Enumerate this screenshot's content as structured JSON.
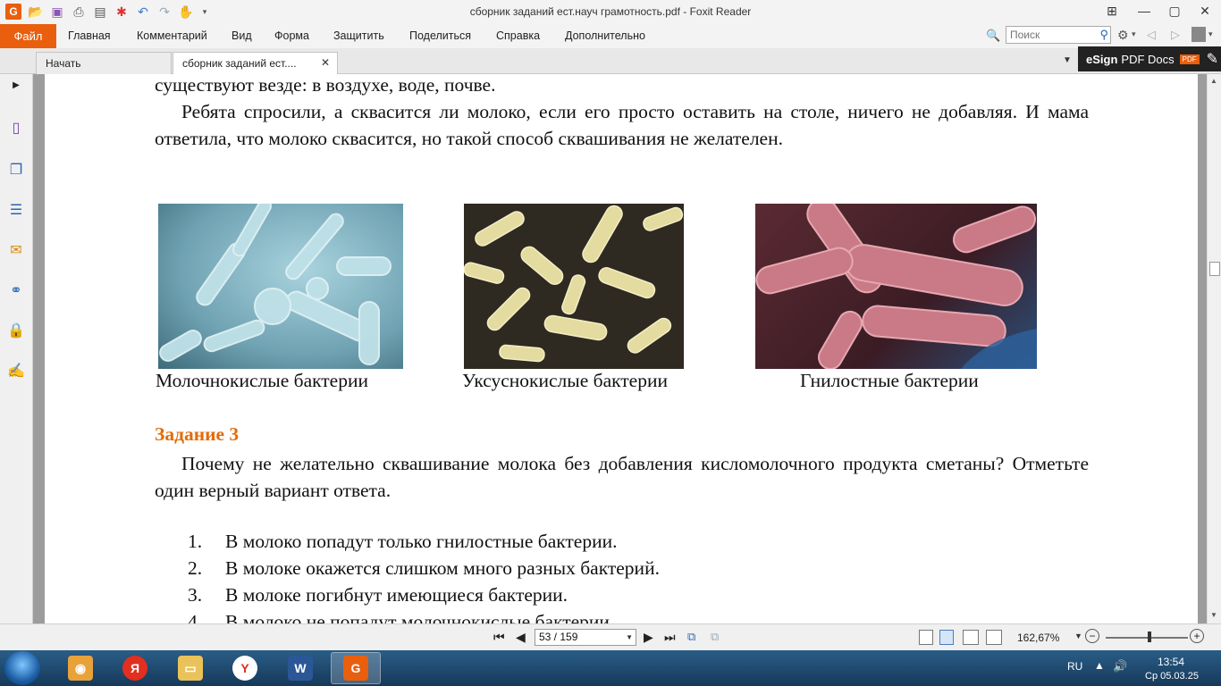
{
  "window": {
    "title": "сборник заданий ест.науч грамотность.pdf - Foxit Reader",
    "controls": {
      "ribbon_toggle": "⊞",
      "minimize": "—",
      "maximize": "▢",
      "close": "✕"
    }
  },
  "menu": {
    "file": "Файл",
    "items": [
      "Главная",
      "Комментарий",
      "Вид",
      "Форма",
      "Защитить",
      "Поделиться",
      "Справка",
      "Дополнительно"
    ]
  },
  "search": {
    "placeholder": "Поиск"
  },
  "tabs": [
    {
      "label": "Начать"
    },
    {
      "label": "сборник заданий ест...."
    }
  ],
  "esign": {
    "brand": "eSign",
    "label": "PDF Docs",
    "badge": "PDF"
  },
  "document": {
    "line_top": "существуют везде: в воздухе, воде, почве.",
    "paragraph1": "Ребята спросили, а сквасится ли молоко, если его просто оставить на столе, ничего не добавляя. И мама ответила, что молоко сквасится, но такой способ сквашивания не желателен.",
    "captions": [
      "Молочнокислые бактерии",
      "Уксуснокислые бактерии",
      "Гнилостные бактерии"
    ],
    "task_heading": "Задание 3",
    "question": "Почему не желательно сквашивание молока без добавления кисломолочного продукта сметаны? Отметьте один верный вариант ответа.",
    "options": [
      {
        "num": "1.",
        "text": "В молоко попадут только гнилостные бактерии."
      },
      {
        "num": "2.",
        "text": "В молоке окажется слишком много разных бактерий."
      },
      {
        "num": "3.",
        "text": "В молоке погибнут имеющиеся бактерии."
      },
      {
        "num": "4.",
        "text": "В молоко не попадут молочнокислые бактерии."
      }
    ]
  },
  "status": {
    "page_value": "53 / 159",
    "zoom": "162,67%",
    "zoom_level": 0.53
  },
  "taskbar": {
    "lang": "RU",
    "time": "13:54",
    "date": "Ср 05.03.25"
  }
}
